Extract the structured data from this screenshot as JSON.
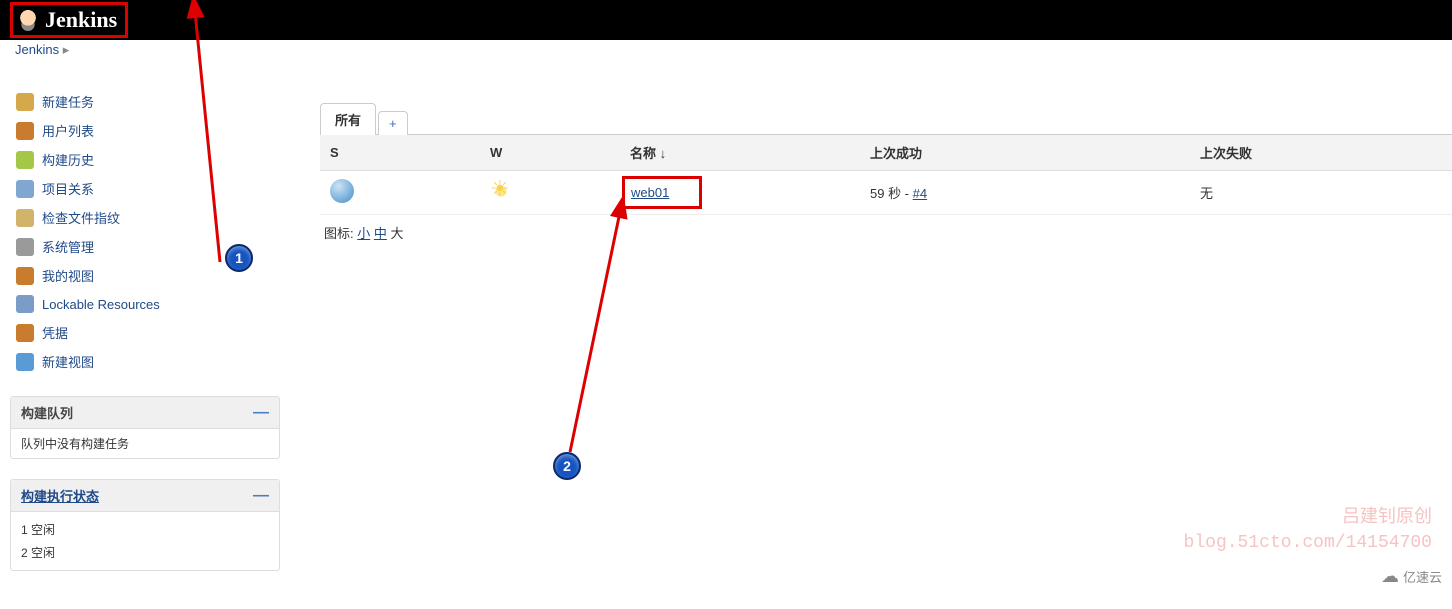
{
  "header": {
    "logo_text": "Jenkins"
  },
  "breadcrumb": {
    "root": "Jenkins"
  },
  "sidebar": {
    "items": [
      {
        "label": "新建任务",
        "icon": "new-item-icon",
        "color": "#d4a84b"
      },
      {
        "label": "用户列表",
        "icon": "people-icon",
        "color": "#c97b2e"
      },
      {
        "label": "构建历史",
        "icon": "history-icon",
        "color": "#a5c747"
      },
      {
        "label": "项目关系",
        "icon": "relation-icon",
        "color": "#7fa7d1"
      },
      {
        "label": "检查文件指纹",
        "icon": "fingerprint-icon",
        "color": "#d1b36b"
      },
      {
        "label": "系统管理",
        "icon": "manage-icon",
        "color": "#9a9a9a"
      },
      {
        "label": "我的视图",
        "icon": "my-views-icon",
        "color": "#c97b2e"
      },
      {
        "label": "Lockable Resources",
        "icon": "lock-icon",
        "color": "#7a9cc6"
      },
      {
        "label": "凭据",
        "icon": "credentials-icon",
        "color": "#c97b2e"
      },
      {
        "label": "新建视图",
        "icon": "new-view-icon",
        "color": "#5a9bd5"
      }
    ],
    "queue": {
      "title": "构建队列",
      "empty_text": "队列中没有构建任务",
      "collapse": "—"
    },
    "executors": {
      "title": "构建执行状态",
      "collapse": "—",
      "rows": [
        {
          "num": "1",
          "status": "空闲"
        },
        {
          "num": "2",
          "status": "空闲"
        }
      ]
    }
  },
  "main": {
    "tabs": {
      "active": "所有",
      "add": "+"
    },
    "columns": {
      "s": "S",
      "w": "W",
      "name": "名称 ↓",
      "last_success": "上次成功",
      "last_failure": "上次失败"
    },
    "jobs": [
      {
        "name": "web01",
        "last_success_time": "59 秒",
        "last_success_sep": " - ",
        "last_success_build": "#4",
        "last_failure": "无"
      }
    ],
    "legend": {
      "label": "图标:",
      "sm": "小",
      "md": "中",
      "lg": "大"
    }
  },
  "annotations": {
    "badge1": "1",
    "badge2": "2"
  },
  "watermark": {
    "line1": "吕建钊原创",
    "line2": "blog.51cto.com/14154700"
  },
  "footer": {
    "brand": "亿速云"
  }
}
